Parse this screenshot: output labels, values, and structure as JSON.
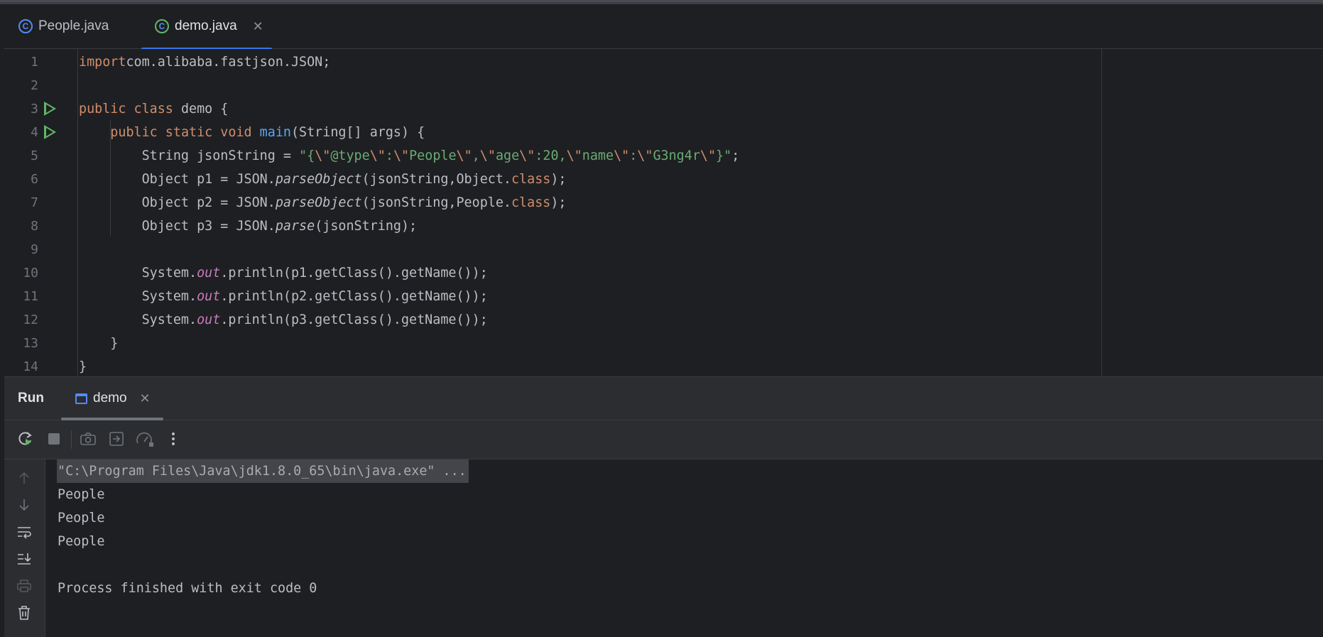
{
  "tabs": [
    {
      "label": "People.java",
      "icon": "class-icon",
      "active": false
    },
    {
      "label": "demo.java",
      "icon": "runnable-class-icon",
      "active": true
    }
  ],
  "editor": {
    "line_numbers": [
      "1",
      "2",
      "3",
      "4",
      "5",
      "6",
      "7",
      "8",
      "9",
      "10",
      "11",
      "12",
      "13",
      "14"
    ],
    "lines": [
      [
        [
          "kw",
          "import"
        ],
        [
          "",
          "com.alibaba.fastjson.JSON;"
        ]
      ],
      [],
      [
        [
          "kw",
          "public class "
        ],
        [
          "",
          "demo {"
        ]
      ],
      [
        [
          "",
          "    "
        ],
        [
          "kw",
          "public static void "
        ],
        [
          "fn",
          "main"
        ],
        [
          "",
          "(String[] args) {"
        ]
      ],
      [
        [
          "",
          "        String jsonString = "
        ],
        [
          "str",
          "\"{"
        ],
        [
          "esc",
          "\\\""
        ],
        [
          "str",
          "@type"
        ],
        [
          "esc",
          "\\\""
        ],
        [
          "str",
          ":"
        ],
        [
          "esc",
          "\\\""
        ],
        [
          "str",
          "People"
        ],
        [
          "esc",
          "\\\""
        ],
        [
          "str",
          ","
        ],
        [
          "esc",
          "\\\""
        ],
        [
          "str",
          "age"
        ],
        [
          "esc",
          "\\\""
        ],
        [
          "str",
          ":20,"
        ],
        [
          "esc",
          "\\\""
        ],
        [
          "str",
          "name"
        ],
        [
          "esc",
          "\\\""
        ],
        [
          "str",
          ":"
        ],
        [
          "esc",
          "\\\""
        ],
        [
          "str",
          "G3ng4r"
        ],
        [
          "esc",
          "\\\""
        ],
        [
          "str",
          "}\""
        ],
        [
          "",
          ";"
        ]
      ],
      [
        [
          "",
          "        Object p1 = JSON."
        ],
        [
          "it",
          "parseObject"
        ],
        [
          "",
          "(jsonString,Object."
        ],
        [
          "kw",
          "class"
        ],
        [
          "",
          ");"
        ]
      ],
      [
        [
          "",
          "        Object p2 = JSON."
        ],
        [
          "it",
          "parseObject"
        ],
        [
          "",
          "(jsonString,People."
        ],
        [
          "kw",
          "class"
        ],
        [
          "",
          ");"
        ]
      ],
      [
        [
          "",
          "        Object p3 = JSON."
        ],
        [
          "it",
          "parse"
        ],
        [
          "",
          "(jsonString);"
        ]
      ],
      [],
      [
        [
          "",
          "        System."
        ],
        [
          "out",
          "out"
        ],
        [
          "",
          ".println(p1.getClass().getName());"
        ]
      ],
      [
        [
          "",
          "        System."
        ],
        [
          "out",
          "out"
        ],
        [
          "",
          ".println(p2.getClass().getName());"
        ]
      ],
      [
        [
          "",
          "        System."
        ],
        [
          "out",
          "out"
        ],
        [
          "",
          ".println(p3.getClass().getName());"
        ]
      ],
      [
        [
          "",
          "    }"
        ]
      ],
      [
        [
          "",
          "}"
        ]
      ]
    ]
  },
  "run_panel": {
    "title": "Run",
    "tab_label": "demo",
    "toolbar_icons": [
      "rerun-icon",
      "stop-icon",
      "screenshot-icon",
      "exit-icon",
      "dashboard-icon",
      "more-icon"
    ],
    "sidebar_icons": [
      "scroll-up-icon",
      "scroll-down-icon",
      "soft-wrap-icon",
      "scroll-to-end-icon",
      "print-icon",
      "clear-icon"
    ],
    "console": {
      "command": "\"C:\\Program Files\\Java\\jdk1.8.0_65\\bin\\java.exe\" ...",
      "output": [
        "People",
        "People",
        "People",
        "",
        "Process finished with exit code 0"
      ]
    }
  },
  "colors": {
    "keyword": "#cf8e6d",
    "function": "#56a8f5",
    "string": "#6aab73",
    "static_field": "#c77dbb",
    "accent": "#3574f0",
    "run_green": "#5fb865"
  }
}
